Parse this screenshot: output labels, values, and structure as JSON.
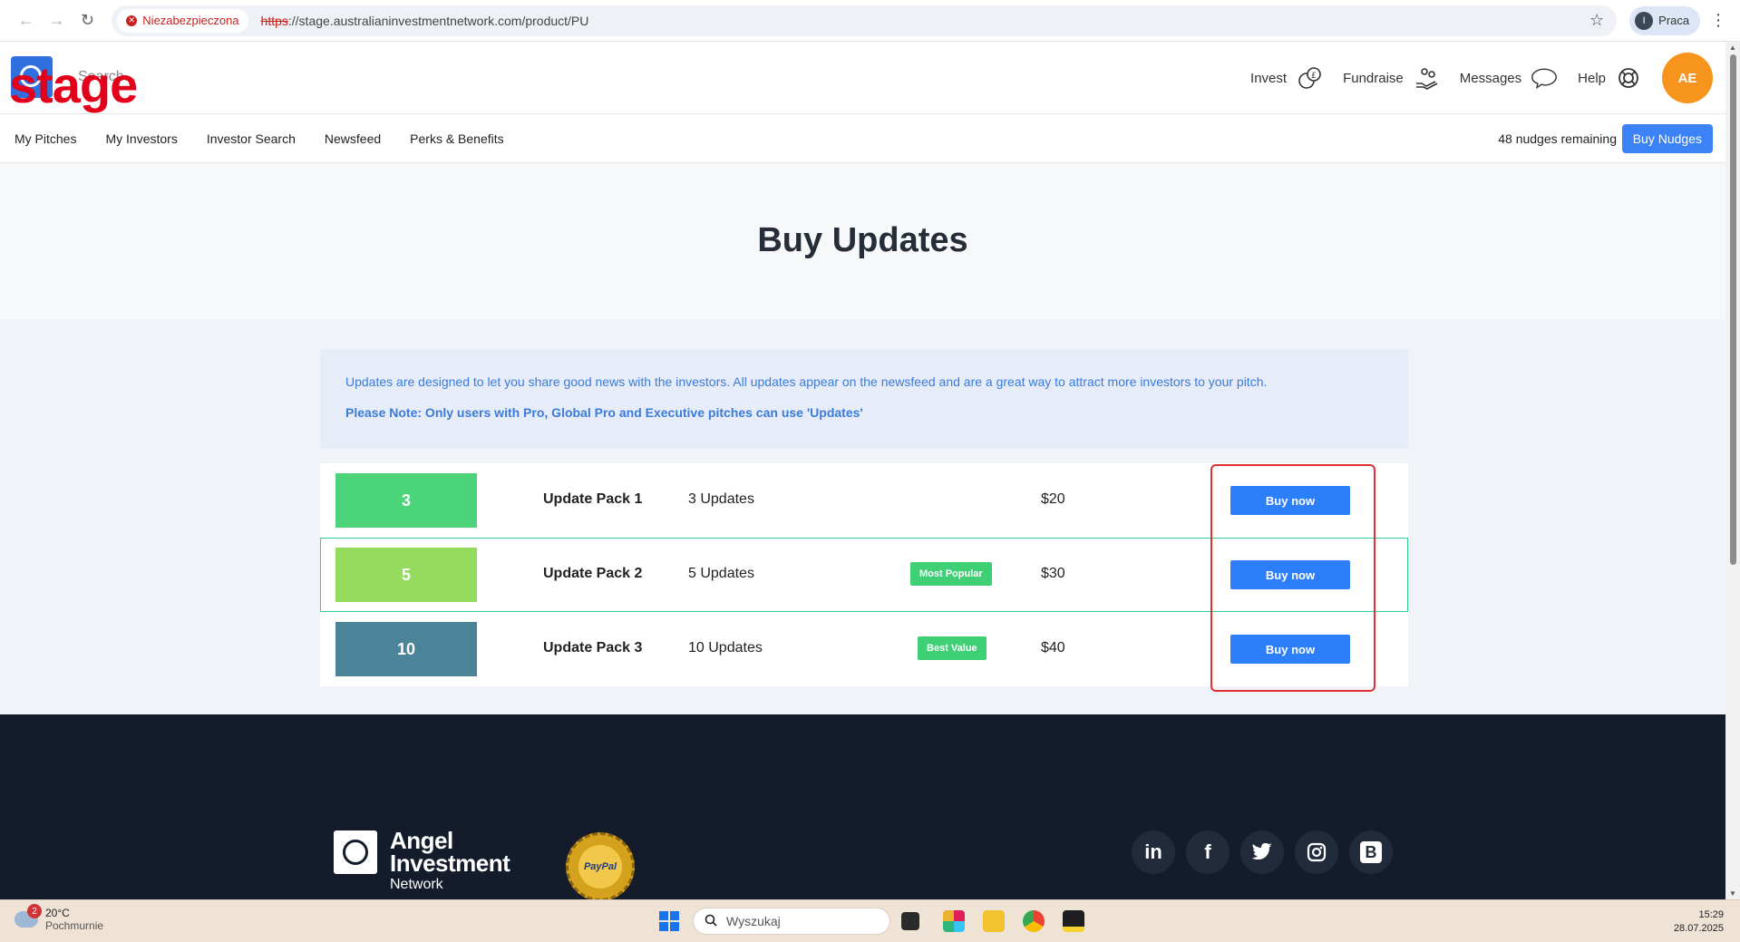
{
  "browser": {
    "security_label": "Niezabezpieczona",
    "url_proto": "https",
    "url_rest": "://stage.australianinvestmentnetwork.com/product/PU",
    "profile_initial": "I",
    "profile_name": "Praca"
  },
  "header": {
    "stage_label": "stage",
    "search_placeholder": "Search...",
    "nav": [
      {
        "label": "Invest",
        "icon": "invest-icon"
      },
      {
        "label": "Fundraise",
        "icon": "fundraise-icon"
      },
      {
        "label": "Messages",
        "icon": "messages-icon"
      },
      {
        "label": "Help",
        "icon": "help-icon"
      }
    ],
    "avatar_initials": "AE"
  },
  "subnav": {
    "links": [
      "My Pitches",
      "My Investors",
      "Investor Search",
      "Newsfeed",
      "Perks & Benefits"
    ],
    "nudges": "48 nudges remaining",
    "buy_nudges": "Buy Nudges"
  },
  "page": {
    "title": "Buy Updates",
    "notice": "Updates are designed to let you share good news with the investors. All updates appear on the newsfeed and are a great way to attract more investors to your pitch.",
    "note": "Please Note: Only users with Pro, Global Pro and Executive pitches can use 'Updates'"
  },
  "packs": [
    {
      "count": "3",
      "name": "Update Pack 1",
      "qty": "3 Updates",
      "badge": "",
      "price": "$20",
      "button": "Buy now",
      "color": "#4cd47a"
    },
    {
      "count": "5",
      "name": "Update Pack 2",
      "qty": "5 Updates",
      "badge": "Most Popular",
      "price": "$30",
      "button": "Buy now",
      "color": "#95dc5e"
    },
    {
      "count": "10",
      "name": "Update Pack 3",
      "qty": "10 Updates",
      "badge": "Best Value",
      "price": "$40",
      "button": "Buy now",
      "color": "#4b8399"
    }
  ],
  "footer": {
    "brand_line1": "Angel",
    "brand_line2": "Investment",
    "brand_line3": "Network",
    "paypal": "PayPal",
    "social": [
      {
        "name": "linkedin-icon",
        "glyph": "in"
      },
      {
        "name": "facebook-icon",
        "glyph": "f"
      },
      {
        "name": "twitter-icon",
        "glyph": "t"
      },
      {
        "name": "instagram-icon",
        "glyph": "◎"
      },
      {
        "name": "blog-icon",
        "glyph": "B"
      }
    ]
  },
  "taskbar": {
    "weather_badge": "2",
    "temp": "20°C",
    "condition": "Pochmurnie",
    "search": "Wyszukaj",
    "time": "15:29",
    "date": "28.07.2025"
  },
  "colors": {
    "accent": "#2d7ff9",
    "badge_green": "#3fcf74",
    "highlight": "#2fcf8f",
    "annotation": "#e03030"
  }
}
